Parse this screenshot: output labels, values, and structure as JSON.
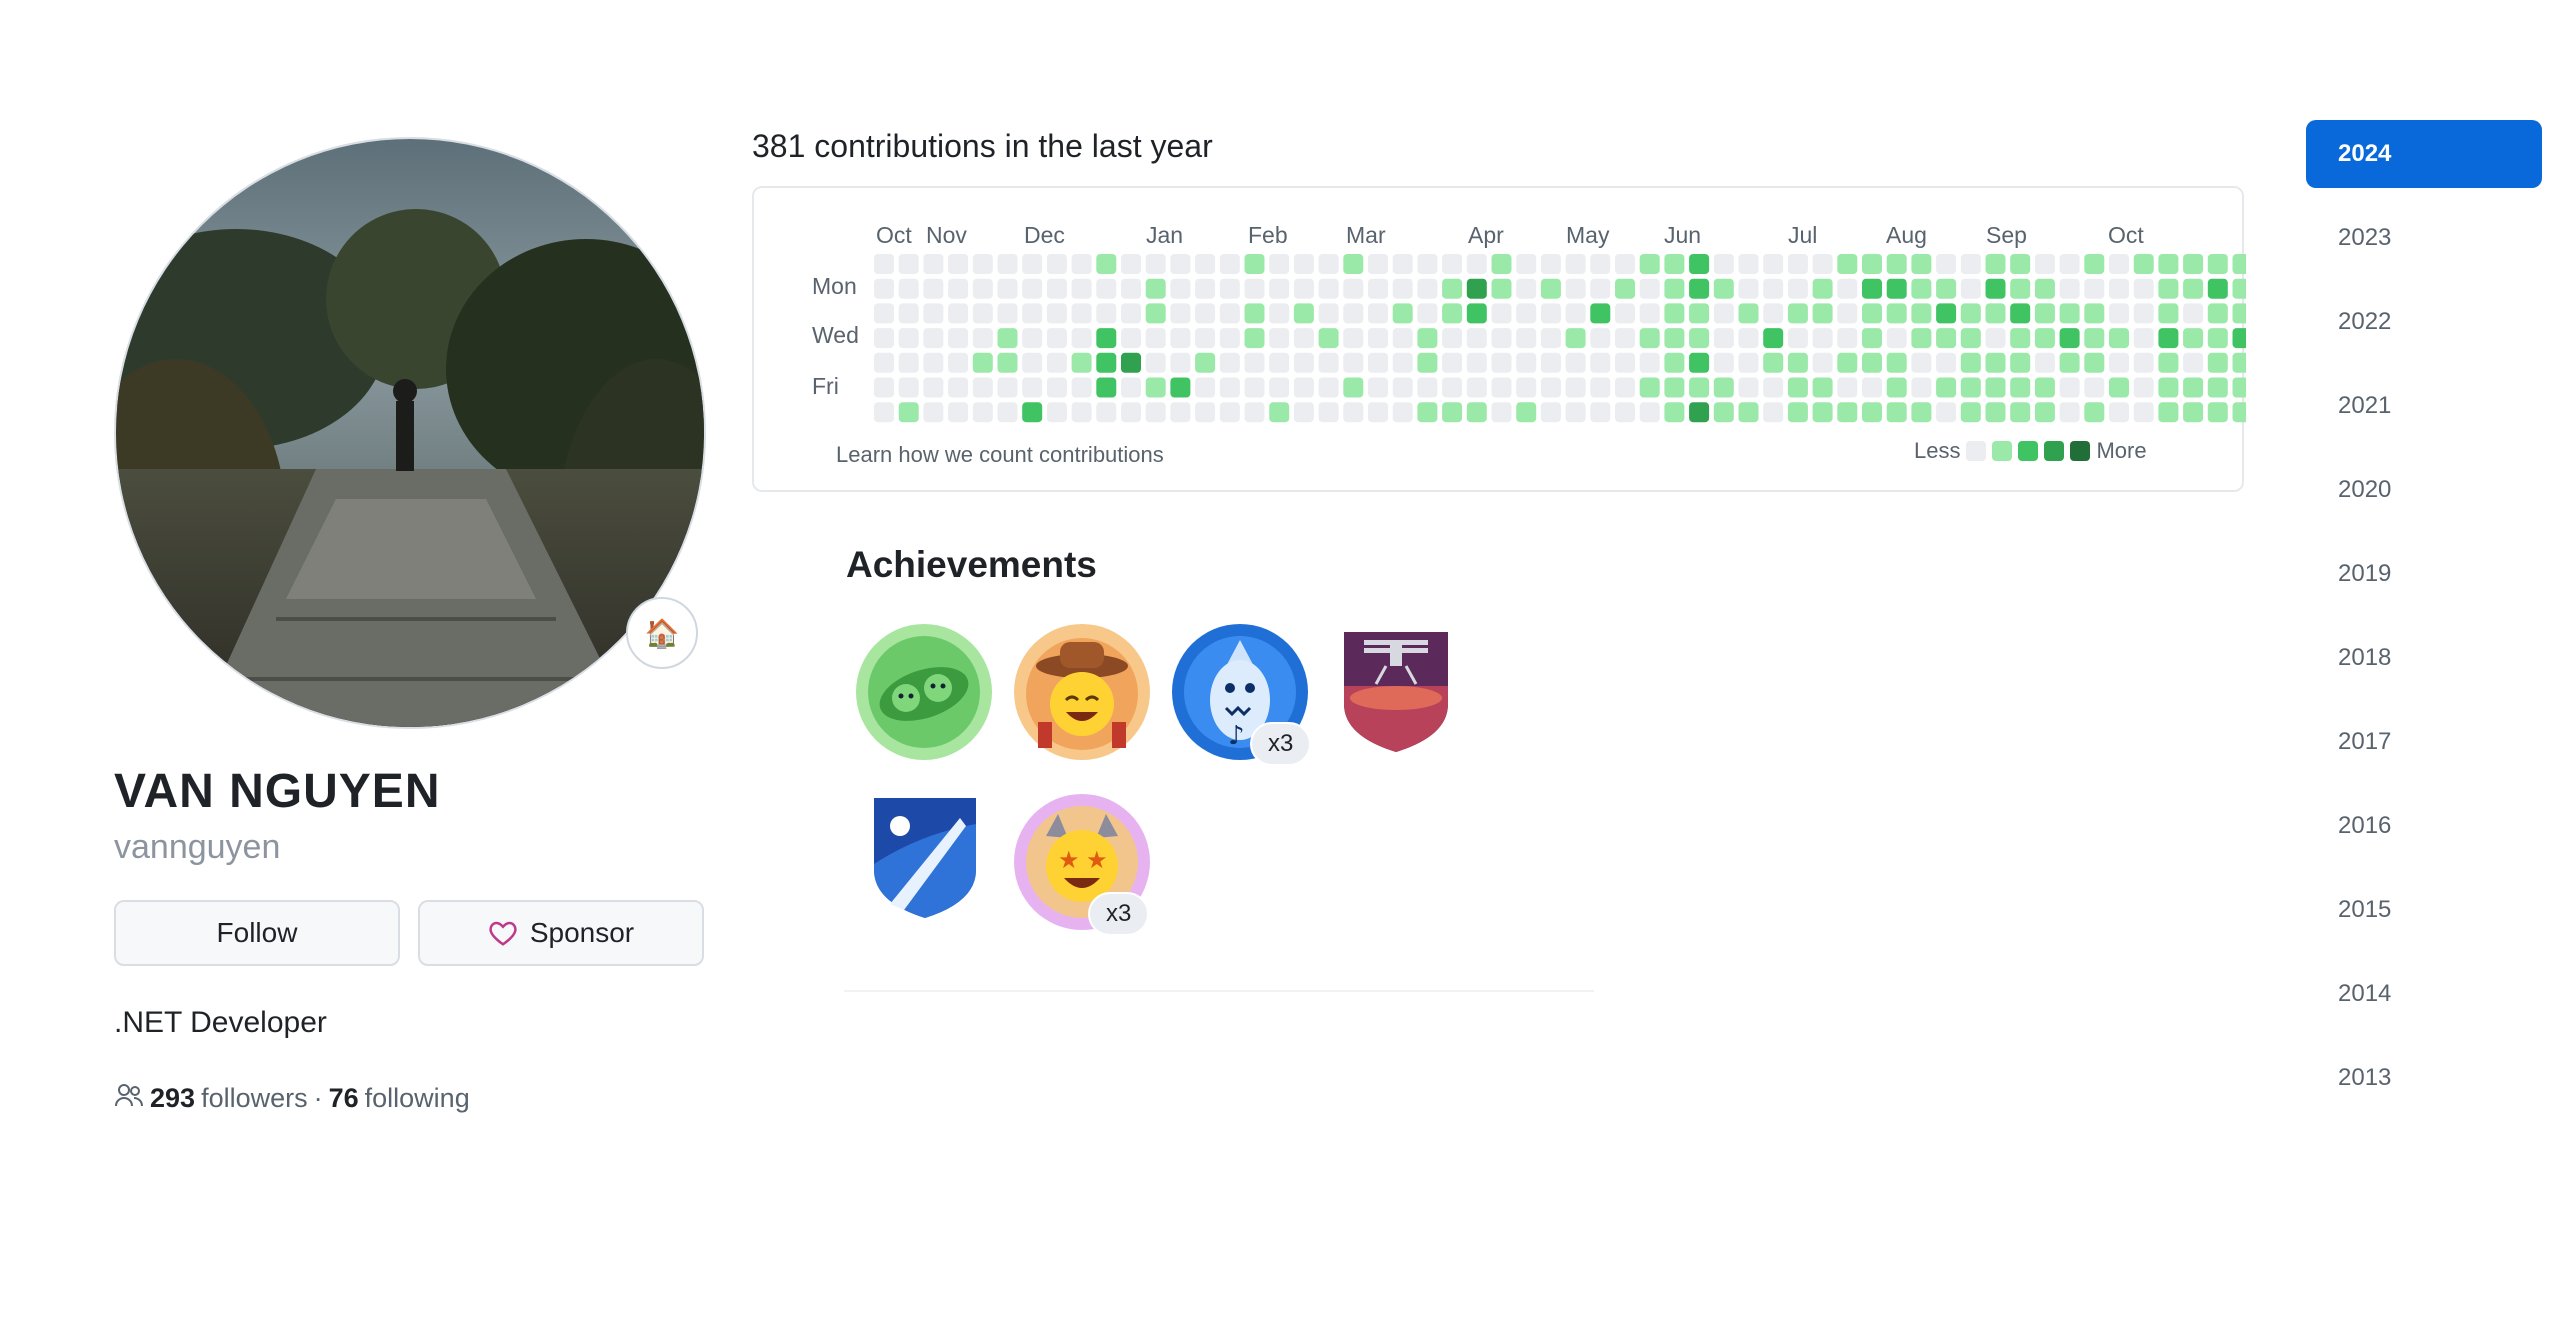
{
  "profile": {
    "full_name": "VAN NGUYEN",
    "username": "vannguyen",
    "status_emoji": "🏠",
    "follow_label": "Follow",
    "sponsor_label": "Sponsor",
    "bio": ".NET Developer",
    "followers_count": "293",
    "followers_label": "followers",
    "separator": "·",
    "following_count": "76",
    "following_label": "following"
  },
  "contributions": {
    "title": "381 contributions in the last year",
    "months": [
      "Oct",
      "Nov",
      "Dec",
      "Jan",
      "Feb",
      "Mar",
      "Apr",
      "May",
      "Jun",
      "Jul",
      "Aug",
      "Sep",
      "Oct"
    ],
    "weekdays": [
      "Mon",
      "Wed",
      "Fri"
    ],
    "learn_link": "Learn how we count contributions",
    "legend_less": "Less",
    "legend_more": "More",
    "colors": [
      "#ebedf0",
      "#9be9a8",
      "#40c463",
      "#30a14e",
      "#216e39"
    ],
    "weeks": [
      [
        0,
        0,
        0,
        0,
        0,
        0,
        0
      ],
      [
        0,
        0,
        0,
        0,
        0,
        0,
        1
      ],
      [
        0,
        0,
        0,
        0,
        0,
        0,
        0
      ],
      [
        0,
        0,
        0,
        0,
        0,
        0,
        0
      ],
      [
        0,
        0,
        0,
        0,
        1,
        0,
        0
      ],
      [
        0,
        0,
        0,
        1,
        1,
        0,
        0
      ],
      [
        0,
        0,
        0,
        0,
        0,
        0,
        2
      ],
      [
        0,
        0,
        0,
        0,
        0,
        0,
        0
      ],
      [
        0,
        0,
        0,
        0,
        1,
        0,
        0
      ],
      [
        1,
        0,
        0,
        2,
        2,
        2,
        0
      ],
      [
        0,
        0,
        0,
        0,
        3,
        0,
        0
      ],
      [
        0,
        1,
        1,
        0,
        0,
        1,
        0
      ],
      [
        0,
        0,
        0,
        0,
        0,
        2,
        0
      ],
      [
        0,
        0,
        0,
        0,
        1,
        0,
        0
      ],
      [
        0,
        0,
        0,
        0,
        0,
        0,
        0
      ],
      [
        1,
        0,
        1,
        1,
        0,
        0,
        0
      ],
      [
        0,
        0,
        0,
        0,
        0,
        0,
        1
      ],
      [
        0,
        0,
        1,
        0,
        0,
        0,
        0
      ],
      [
        0,
        0,
        0,
        1,
        0,
        0,
        0
      ],
      [
        1,
        0,
        0,
        0,
        0,
        1,
        0
      ],
      [
        0,
        0,
        0,
        0,
        0,
        0,
        0
      ],
      [
        0,
        0,
        1,
        0,
        0,
        0,
        0
      ],
      [
        0,
        0,
        0,
        1,
        1,
        0,
        1
      ],
      [
        0,
        1,
        1,
        0,
        0,
        0,
        1
      ],
      [
        0,
        3,
        2,
        0,
        0,
        0,
        1
      ],
      [
        1,
        1,
        0,
        0,
        0,
        0,
        0
      ],
      [
        0,
        0,
        0,
        0,
        0,
        0,
        1
      ],
      [
        0,
        1,
        0,
        0,
        0,
        0,
        0
      ],
      [
        0,
        0,
        0,
        1,
        0,
        0,
        0
      ],
      [
        0,
        0,
        2,
        0,
        0,
        0,
        0
      ],
      [
        0,
        1,
        0,
        0,
        0,
        0,
        0
      ],
      [
        1,
        0,
        0,
        1,
        0,
        1,
        0
      ],
      [
        1,
        1,
        1,
        1,
        1,
        1,
        1
      ],
      [
        2,
        2,
        1,
        1,
        2,
        1,
        3
      ],
      [
        0,
        1,
        0,
        0,
        0,
        1,
        1
      ],
      [
        0,
        0,
        1,
        0,
        0,
        0,
        1
      ],
      [
        0,
        0,
        0,
        2,
        1,
        0,
        0
      ],
      [
        0,
        0,
        1,
        0,
        1,
        1,
        1
      ],
      [
        0,
        1,
        1,
        0,
        0,
        1,
        1
      ],
      [
        1,
        0,
        0,
        0,
        1,
        0,
        1
      ],
      [
        1,
        2,
        1,
        1,
        1,
        0,
        1
      ],
      [
        1,
        2,
        1,
        0,
        1,
        1,
        1
      ],
      [
        1,
        1,
        1,
        1,
        0,
        0,
        1
      ],
      [
        0,
        1,
        2,
        1,
        0,
        1,
        0
      ],
      [
        0,
        0,
        1,
        1,
        1,
        1,
        1
      ],
      [
        1,
        2,
        1,
        0,
        1,
        1,
        1
      ],
      [
        1,
        1,
        2,
        1,
        1,
        1,
        1
      ],
      [
        0,
        1,
        1,
        1,
        0,
        1,
        1
      ],
      [
        0,
        0,
        1,
        2,
        1,
        0,
        0
      ],
      [
        1,
        0,
        1,
        1,
        1,
        0,
        1
      ],
      [
        0,
        0,
        0,
        1,
        0,
        1,
        0
      ],
      [
        1,
        0,
        0,
        0,
        0,
        0,
        0
      ],
      [
        1,
        1,
        1,
        2,
        1,
        1,
        1
      ],
      [
        1,
        1,
        0,
        1,
        0,
        1,
        1
      ],
      [
        1,
        2,
        1,
        1,
        1,
        1,
        1
      ],
      [
        1,
        1,
        1,
        2,
        1,
        1,
        1
      ]
    ]
  },
  "achievements": {
    "title": "Achievements",
    "badges": [
      {
        "name": "pair-extraordinaire-badge",
        "emoji": "🫛",
        "count": ""
      },
      {
        "name": "yolo-badge",
        "emoji": "🤠",
        "count": ""
      },
      {
        "name": "pull-shark-badge",
        "emoji": "🦈",
        "count": "x3"
      },
      {
        "name": "mars-2020-badge",
        "emoji": "🚁",
        "count": ""
      },
      {
        "name": "arctic-code-vault-badge",
        "emoji": "🏔",
        "count": ""
      },
      {
        "name": "starstruck-badge",
        "emoji": "🤩",
        "count": "x3"
      }
    ]
  },
  "years": [
    "2024",
    "2023",
    "2022",
    "2021",
    "2020",
    "2019",
    "2018",
    "2017",
    "2016",
    "2015",
    "2014",
    "2013"
  ],
  "active_year": "2024"
}
